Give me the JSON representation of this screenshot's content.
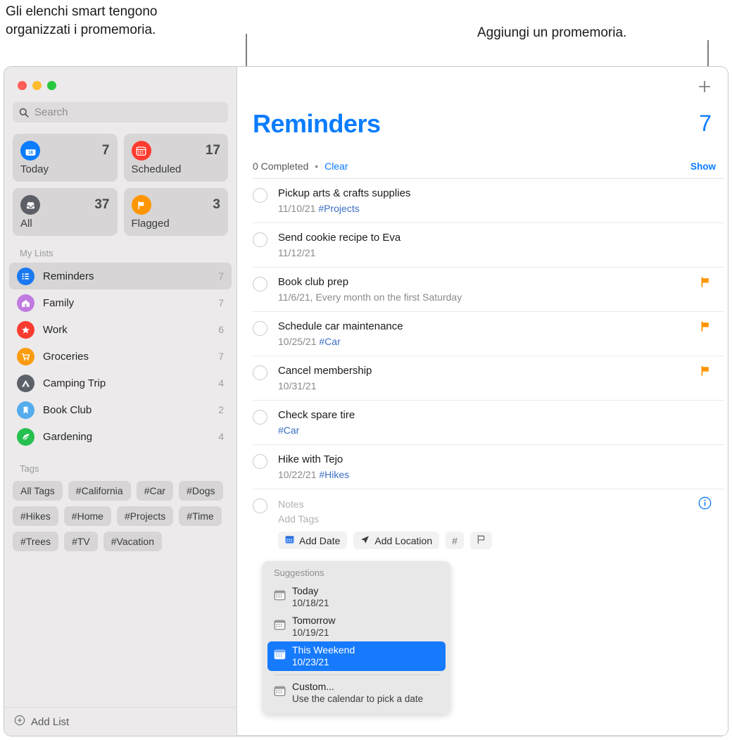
{
  "callouts": {
    "left": "Gli elenchi smart tengono\norganizzati i promemoria.",
    "right": "Aggiungi un promemoria."
  },
  "window": {
    "traffic_lights": [
      "close-red",
      "minimize-yellow",
      "zoom-green"
    ]
  },
  "sidebar": {
    "search": {
      "placeholder": "Search",
      "icon": "search-icon"
    },
    "smart_lists": [
      {
        "label": "Today",
        "count": "7",
        "icon": "calendar-today-icon",
        "color": "#0a7cff",
        "day": "18"
      },
      {
        "label": "Scheduled",
        "count": "17",
        "icon": "calendar-icon",
        "color": "#ff3b30"
      },
      {
        "label": "All",
        "count": "37",
        "icon": "inbox-icon",
        "color": "#5c5f66"
      },
      {
        "label": "Flagged",
        "count": "3",
        "icon": "flag-icon",
        "color": "#ff9500"
      }
    ],
    "my_lists_header": "My Lists",
    "lists": [
      {
        "label": "Reminders",
        "count": "7",
        "icon": "list-bullet-icon",
        "color": "#1a79f0",
        "selected": true
      },
      {
        "label": "Family",
        "count": "7",
        "icon": "house-icon",
        "color": "#c07ae0",
        "selected": false
      },
      {
        "label": "Work",
        "count": "6",
        "icon": "star-icon",
        "color": "#fa3b30",
        "selected": false
      },
      {
        "label": "Groceries",
        "count": "7",
        "icon": "cart-icon",
        "color": "#fb9b10",
        "selected": false
      },
      {
        "label": "Camping Trip",
        "count": "4",
        "icon": "tent-icon",
        "color": "#5c6169",
        "selected": false
      },
      {
        "label": "Book Club",
        "count": "2",
        "icon": "bookmark-icon",
        "color": "#55aced",
        "selected": false
      },
      {
        "label": "Gardening",
        "count": "4",
        "icon": "leaf-icon",
        "color": "#25c04e",
        "selected": false
      }
    ],
    "tags_header": "Tags",
    "tags": [
      "All Tags",
      "#California",
      "#Car",
      "#Dogs",
      "#Hikes",
      "#Home",
      "#Projects",
      "#Time",
      "#Trees",
      "#TV",
      "#Vacation"
    ],
    "add_list": {
      "label": "Add List",
      "icon": "plus-circle-icon"
    }
  },
  "main": {
    "add_button_icon": "plus-icon",
    "title": "Reminders",
    "count": "7",
    "completed_text": "0 Completed",
    "separator": "•",
    "clear_label": "Clear",
    "show_label": "Show",
    "accent_color": "#0a7cff",
    "flag_color": "#ff9500",
    "reminders": [
      {
        "title": "Pickup arts & crafts supplies",
        "date": "11/10/21",
        "tag": "#Projects",
        "flagged": false
      },
      {
        "title": "Send cookie recipe to Eva",
        "date": "11/12/21",
        "tag": "",
        "flagged": false
      },
      {
        "title": "Book club prep",
        "date": "11/6/21, Every month on the first Saturday",
        "tag": "",
        "flagged": true
      },
      {
        "title": "Schedule car maintenance",
        "date": "10/25/21",
        "tag": "#Car",
        "flagged": true
      },
      {
        "title": "Cancel membership",
        "date": "10/31/21",
        "tag": "",
        "flagged": true
      },
      {
        "title": "Check spare tire",
        "date": "",
        "tag": "#Car",
        "flagged": false
      },
      {
        "title": "Hike with Tejo",
        "date": "10/22/21",
        "tag": "#Hikes",
        "flagged": false
      }
    ],
    "editor": {
      "notes_placeholder": "Notes",
      "tags_placeholder": "Add Tags",
      "add_date_label": "Add Date",
      "add_location_label": "Add Location",
      "tag_chip_label": "#",
      "flag_chip_icon": "flag-outline-icon",
      "date_chip_icon": "calendar-icon",
      "location_chip_icon": "location-arrow-icon",
      "info_icon": "info-circle-icon"
    }
  },
  "suggestions": {
    "header": "Suggestions",
    "items": [
      {
        "title": "Today",
        "subtitle": "10/18/21",
        "selected": false
      },
      {
        "title": "Tomorrow",
        "subtitle": "10/19/21",
        "selected": false
      },
      {
        "title": "This Weekend",
        "subtitle": "10/23/21",
        "selected": true
      }
    ],
    "custom": {
      "title": "Custom...",
      "subtitle": "Use the calendar to pick a date",
      "selected": false
    },
    "highlight_color": "#167afc"
  }
}
